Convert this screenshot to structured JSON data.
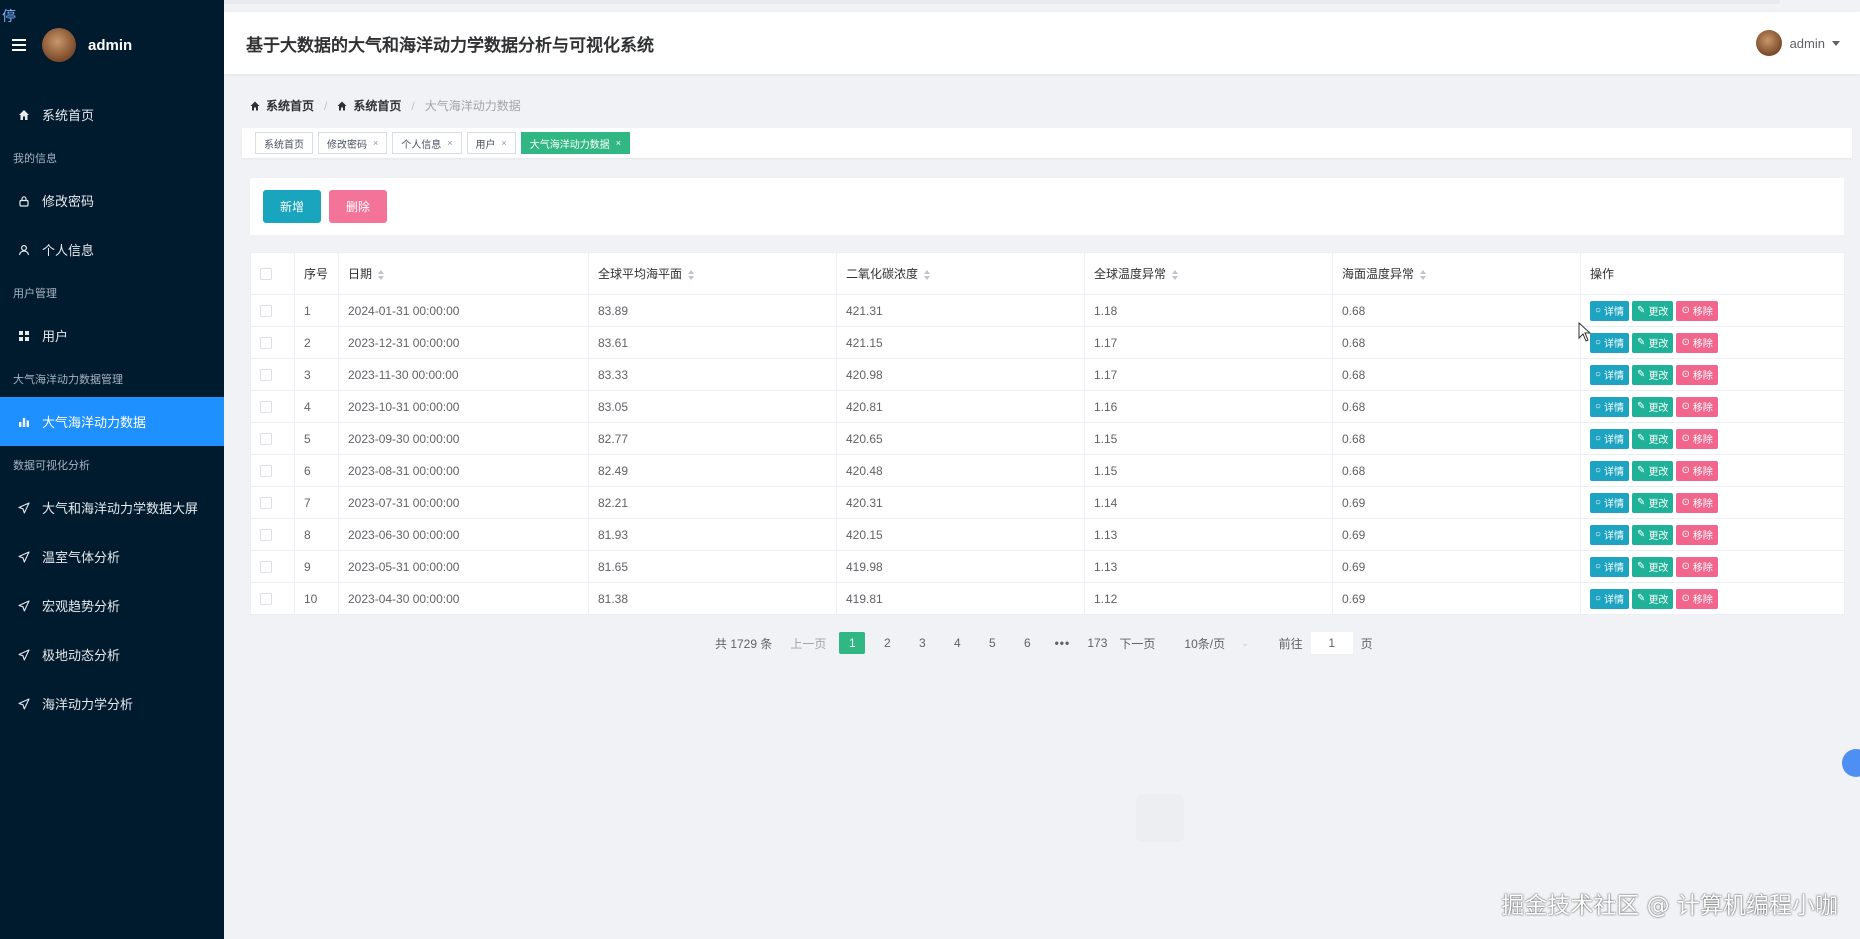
{
  "sidebar": {
    "user": "admin",
    "stop_mark": "停",
    "items": [
      {
        "type": "item",
        "label": "系统首页",
        "icon": "home-icon",
        "name": "sidebar-item-home"
      },
      {
        "type": "group",
        "label": "我的信息"
      },
      {
        "type": "item",
        "label": "修改密码",
        "icon": "lock-icon",
        "name": "sidebar-item-change-password"
      },
      {
        "type": "item",
        "label": "个人信息",
        "icon": "user-icon",
        "name": "sidebar-item-profile"
      },
      {
        "type": "group",
        "label": "用户管理"
      },
      {
        "type": "item",
        "label": "用户",
        "icon": "grid-icon",
        "name": "sidebar-item-users"
      },
      {
        "type": "group",
        "label": "大气海洋动力数据管理"
      },
      {
        "type": "item",
        "label": "大气海洋动力数据",
        "icon": "bar-chart-icon",
        "name": "sidebar-item-ocean-data",
        "active": true
      },
      {
        "type": "group",
        "label": "数据可视化分析"
      },
      {
        "type": "item",
        "label": "大气和海洋动力学数据大屏",
        "icon": "send-icon",
        "name": "sidebar-item-dashboard"
      },
      {
        "type": "item",
        "label": "温室气体分析",
        "icon": "send-icon",
        "name": "sidebar-item-greenhouse"
      },
      {
        "type": "item",
        "label": "宏观趋势分析",
        "icon": "send-icon",
        "name": "sidebar-item-macro-trend"
      },
      {
        "type": "item",
        "label": "极地动态分析",
        "icon": "send-icon",
        "name": "sidebar-item-polar"
      },
      {
        "type": "item",
        "label": "海洋动力学分析",
        "icon": "send-icon",
        "name": "sidebar-item-ocean-dynamics"
      }
    ]
  },
  "header": {
    "title": "基于大数据的大气和海洋动力学数据分析与可视化系统",
    "user": "admin"
  },
  "breadcrumb": {
    "items": [
      "系统首页",
      "系统首页"
    ],
    "current": "大气海洋动力数据"
  },
  "tags": [
    {
      "label": "系统首页",
      "closable": false
    },
    {
      "label": "修改密码",
      "closable": true
    },
    {
      "label": "个人信息",
      "closable": true
    },
    {
      "label": "用户",
      "closable": true
    },
    {
      "label": "大气海洋动力数据",
      "closable": true,
      "active": true
    }
  ],
  "tag_close": "×",
  "toolbar": {
    "add_label": "新增",
    "delete_label": "删除"
  },
  "table": {
    "columns": [
      "序号",
      "日期",
      "全球平均海平面",
      "二氧化碳浓度",
      "全球温度异常",
      "海面温度异常",
      "操作"
    ],
    "actions": {
      "detail": "详情",
      "edit": "更改",
      "remove": "移除"
    },
    "rows": [
      [
        "1",
        "2024-01-31 00:00:00",
        "83.89",
        "421.31",
        "1.18",
        "0.68"
      ],
      [
        "2",
        "2023-12-31 00:00:00",
        "83.61",
        "421.15",
        "1.17",
        "0.68"
      ],
      [
        "3",
        "2023-11-30 00:00:00",
        "83.33",
        "420.98",
        "1.17",
        "0.68"
      ],
      [
        "4",
        "2023-10-31 00:00:00",
        "83.05",
        "420.81",
        "1.16",
        "0.68"
      ],
      [
        "5",
        "2023-09-30 00:00:00",
        "82.77",
        "420.65",
        "1.15",
        "0.68"
      ],
      [
        "6",
        "2023-08-31 00:00:00",
        "82.49",
        "420.48",
        "1.15",
        "0.68"
      ],
      [
        "7",
        "2023-07-31 00:00:00",
        "82.21",
        "420.31",
        "1.14",
        "0.69"
      ],
      [
        "8",
        "2023-06-30 00:00:00",
        "81.93",
        "420.15",
        "1.13",
        "0.69"
      ],
      [
        "9",
        "2023-05-31 00:00:00",
        "81.65",
        "419.98",
        "1.13",
        "0.69"
      ],
      [
        "10",
        "2023-04-30 00:00:00",
        "81.38",
        "419.81",
        "1.12",
        "0.69"
      ]
    ]
  },
  "pagination": {
    "total": "共 1729 条",
    "prev": "上一页",
    "next": "下一页",
    "pages": [
      "1",
      "2",
      "3",
      "4",
      "5",
      "6"
    ],
    "current_page": "1",
    "ellipsis": "•••",
    "last_page": "173",
    "page_size": "10条/页",
    "goto_label": "前往",
    "goto_value": "1",
    "goto_suffix": "页"
  },
  "watermark": "掘金技术社区 @ 计算机编程小咖",
  "colors": {
    "sidebar_bg": "#001a2e",
    "active_menu": "#1e90ff",
    "accent_green": "#31b784",
    "add_button": "#19a5bd",
    "delete_button": "#f47398",
    "detail_button": "#1ea3c0",
    "edit_button": "#20b298",
    "remove_button": "#f2658d"
  }
}
